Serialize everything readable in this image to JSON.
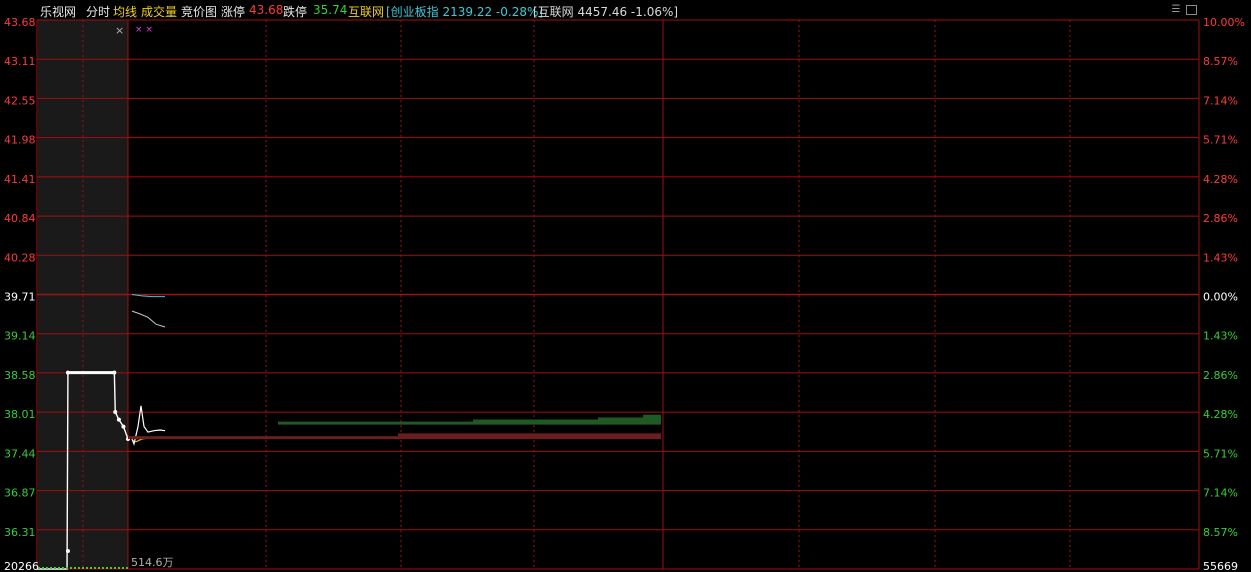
{
  "header": {
    "stock_name": "乐视网",
    "tab_intraday": "分时",
    "tab_avg": "均线",
    "tab_volume": "成交量",
    "tab_auction": "竞价图",
    "limit_up_label": "涨停",
    "limit_up_value": "43.68",
    "limit_down_label": "跌停",
    "limit_down_value": "35.74",
    "sector_name": "互联网",
    "index1": "[创业板指 2139.22 -0.28%]",
    "index2": "[互联网 4457.46 -1.06%]"
  },
  "colors": {
    "up": "#ff3a3a",
    "down": "#35d035",
    "flat": "#ffffff",
    "grid": "#a01010",
    "price_line": "#ffffff",
    "avg_line": "#f0c020",
    "cyan": "#40c8d8",
    "dim_grey": "#1a1a1a"
  },
  "icons": {
    "close_pre": "close-icon",
    "minimize": "minimize-icon",
    "window": "window-icon",
    "markers": "pink-x-markers"
  },
  "chart_data": {
    "type": "line",
    "left_axis": [
      "43.68",
      "43.11",
      "42.55",
      "41.98",
      "41.41",
      "40.84",
      "40.28",
      "39.71",
      "39.14",
      "38.58",
      "38.01",
      "37.44",
      "36.87",
      "36.31",
      "20266"
    ],
    "right_axis": [
      "10.00%",
      "8.57%",
      "7.14%",
      "5.71%",
      "4.28%",
      "2.86%",
      "1.43%",
      "0.00%",
      "1.43%",
      "2.86%",
      "4.28%",
      "5.71%",
      "7.14%",
      "8.57%",
      "55669"
    ],
    "ylim": [
      35.74,
      43.68
    ],
    "prev_close": 39.71,
    "volume_label": "514.6万",
    "auction_series": {
      "name": "",
      "points": [
        [
          0,
          35.74
        ],
        [
          0.06,
          35.74
        ],
        [
          0.33,
          35.74
        ],
        [
          0.34,
          38.58
        ],
        [
          0.85,
          38.58
        ],
        [
          0.86,
          38.01
        ],
        [
          0.9,
          37.9
        ],
        [
          0.95,
          37.8
        ],
        [
          1.0,
          37.62
        ]
      ]
    },
    "price_series": {
      "name": "",
      "points": [
        [
          0,
          37.62
        ],
        [
          2,
          37.55
        ],
        [
          6,
          37.8
        ],
        [
          9,
          38.1
        ],
        [
          12,
          37.8
        ],
        [
          16,
          37.72
        ],
        [
          22,
          37.74
        ],
        [
          28,
          37.75
        ],
        [
          33,
          37.74
        ]
      ]
    },
    "avg_series": {
      "name": "",
      "points": [
        [
          0,
          37.6
        ],
        [
          4,
          37.58
        ],
        [
          10,
          37.62
        ],
        [
          18,
          37.64
        ],
        [
          26,
          37.65
        ],
        [
          33,
          37.65
        ]
      ]
    },
    "index_series": [
      {
        "name": "",
        "points": [
          [
            0,
            39.71
          ],
          [
            10,
            39.69
          ],
          [
            20,
            39.68
          ],
          [
            33,
            39.68
          ]
        ]
      },
      {
        "name": "",
        "points": [
          [
            0,
            39.47
          ],
          [
            8,
            39.43
          ],
          [
            16,
            39.38
          ],
          [
            24,
            39.28
          ],
          [
            33,
            39.24
          ]
        ]
      }
    ],
    "order_bars": [
      {
        "side": "buy",
        "price": 37.85,
        "start": 150,
        "end": 533
      },
      {
        "side": "buy",
        "price": 37.88,
        "start": 345,
        "end": 533
      },
      {
        "side": "buy",
        "price": 37.91,
        "start": 470,
        "end": 533
      },
      {
        "side": "buy",
        "price": 37.95,
        "start": 515,
        "end": 533
      },
      {
        "side": "sell",
        "price": 37.68,
        "start": 270,
        "end": 533
      },
      {
        "side": "sell",
        "price": 37.66,
        "start": 500,
        "end": 533
      },
      {
        "side": "sell",
        "price": 37.64,
        "start": 0,
        "end": 533
      }
    ]
  }
}
